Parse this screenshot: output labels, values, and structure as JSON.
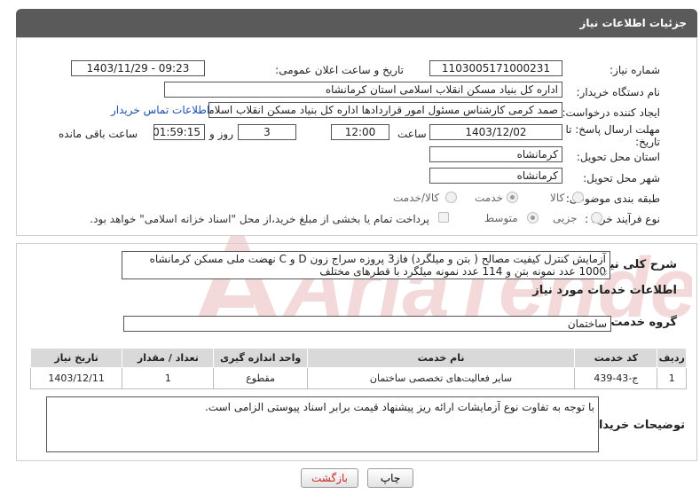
{
  "header": {
    "title": "جزئیات اطلاعات نیاز"
  },
  "form": {
    "need_number": {
      "label": "شماره نیاز:",
      "value": "1103005171000231"
    },
    "announce": {
      "label": "تاریخ و ساعت اعلان عمومی:",
      "value": "1403/11/29 - 09:23"
    },
    "buyer": {
      "label": "نام دستگاه خریدار:",
      "value": "اداره کل بنیاد مسکن انقلاب اسلامی استان کرمانشاه"
    },
    "requester": {
      "label": "ایجاد کننده درخواست:",
      "value": "صمد کرمی کارشناس مسئول امور قراردادها اداره کل بنیاد مسکن انقلاب اسلامی",
      "contact_link": "اطلاعات تماس خریدار"
    },
    "deadline": {
      "label_line1": "مهلت ارسال پاسخ: تا",
      "label_line2": "تاریخ:",
      "date": "1403/12/02",
      "time_label": "ساعت",
      "time": "12:00",
      "days": "3",
      "days_label": "روز و",
      "remaining": "01:59:15",
      "remaining_label": "ساعت باقی مانده"
    },
    "province": {
      "label": "استان محل تحویل:",
      "value": "کرمانشاه"
    },
    "city": {
      "label": "شهر محل تحویل:",
      "value": "کرمانشاه"
    },
    "category": {
      "label": "طبقه بندی موضوعی:",
      "options": [
        "کالا",
        "خدمت",
        "کالا/خدمت"
      ],
      "selected": "خدمت"
    },
    "process": {
      "label": "نوع فرآیند خرید :",
      "options": [
        "جزیی",
        "متوسط"
      ],
      "selected": "متوسط",
      "payment_note": "پرداخت تمام یا بخشی از مبلغ خرید،از محل \"اسناد خزانه اسلامی\" خواهد بود."
    }
  },
  "summary": {
    "label": "شرح کلی نیاز:",
    "line1": "آزمایش کنترل کیفیت مصالح ( بتن و میلگرد) فاز3 پروزه سراج زون D و C نهضت ملی مسکن کرمانشاه",
    "line2": "1000 عدد نمونه بتن و 114 عدد نمونه میلگرد با قطرهای مختلف"
  },
  "services": {
    "section_title": "اطلاعات خدمات مورد نیاز",
    "group_label": "گروه خدمت:",
    "group_value": "ساختمان",
    "columns": [
      "ردیف",
      "کد خدمت",
      "نام خدمت",
      "واحد اندازه گیری",
      "تعداد / مقدار",
      "تاریخ نیاز"
    ],
    "rows": [
      [
        "1",
        "ج-43-439",
        "سایر فعالیت‌های تخصصی ساختمان",
        "مقطوع",
        "1",
        "1403/12/11"
      ]
    ]
  },
  "buyer_notes": {
    "label": "توضیحات خریدار:",
    "value": "با توجه به تفاوت نوع آزمایشات ارائه ریز پیشنهاد قیمت برابر اسناد پیوستی الزامی است."
  },
  "buttons": {
    "print": "چاپ",
    "back": "بازگشت"
  },
  "watermark": {
    "text": "AriaTender.neT"
  },
  "colors": {
    "header_bg": "#5a5a5a",
    "link": "#1a4fb0",
    "back_text": "#c62828",
    "watermark": "#b71c1c"
  }
}
